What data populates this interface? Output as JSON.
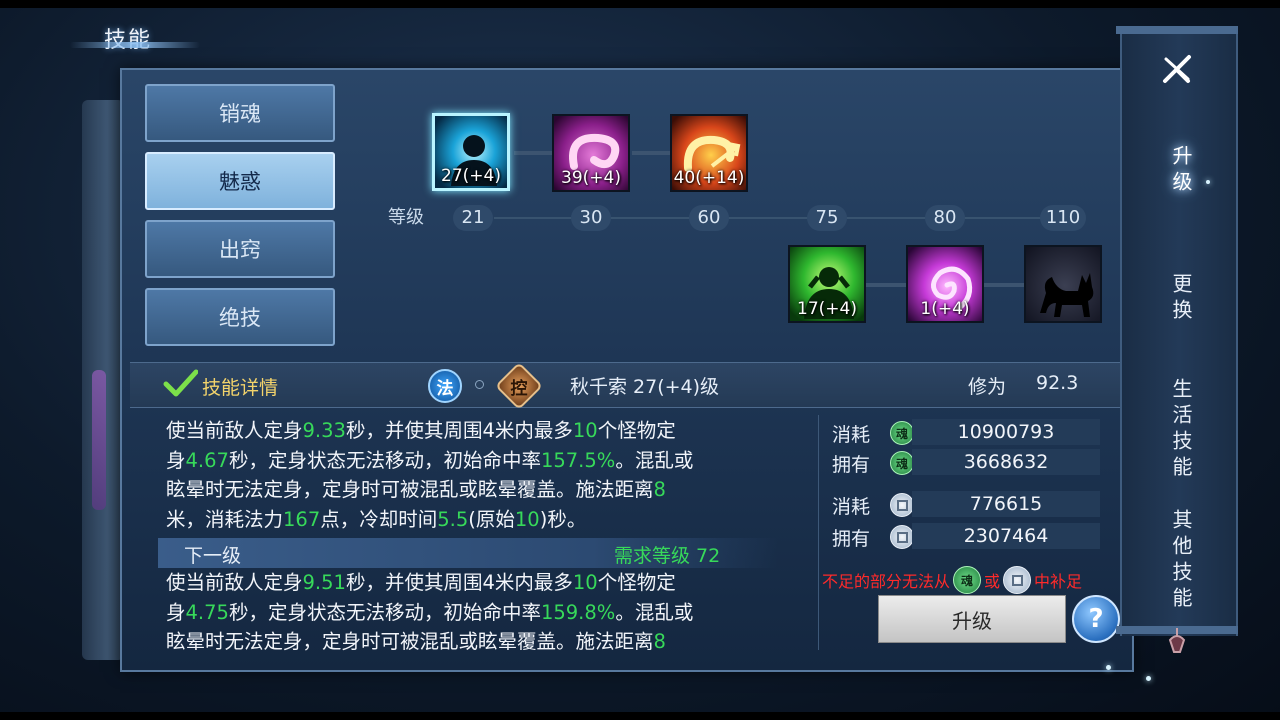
{
  "screen": {
    "title": "技能"
  },
  "tabs": [
    {
      "label": "销魂",
      "active": false
    },
    {
      "label": "魅惑",
      "active": true
    },
    {
      "label": "出窍",
      "active": false
    },
    {
      "label": "绝技",
      "active": false
    }
  ],
  "skill_tree": {
    "level_label": "等级",
    "levels": [
      "21",
      "30",
      "60",
      "75",
      "80",
      "110"
    ],
    "row1": [
      {
        "icon": "silhouette-skill-icon",
        "level_text": "27(+4)",
        "selected": true
      },
      {
        "icon": "pink-ribbon-skill-icon",
        "level_text": "39(+4)"
      },
      {
        "icon": "fire-arrow-skill-icon",
        "level_text": "40(+14)"
      }
    ],
    "row2": [
      {
        "icon": "green-figure-skill-icon",
        "level_text": "17(+4)"
      },
      {
        "icon": "purple-vortex-skill-icon",
        "level_text": "1(+4)"
      },
      {
        "icon": "fox-silhouette-skill-icon",
        "level_text": ""
      }
    ]
  },
  "detail": {
    "label": "技能详情",
    "badge_fa": "法",
    "badge_kong": "控",
    "skill_name": "秋千索 27(+4)级",
    "xiuwei_label": "修为",
    "xiuwei_value": "92.3",
    "current": {
      "line1": [
        "使当前敌人定身",
        "9.33",
        "秒，并使其周围4米内最多",
        "10",
        "个怪物定"
      ],
      "line2": [
        "身",
        "4.67",
        "秒，定身状态无法移动，初始命中率",
        "157.5%",
        "。混乱或"
      ],
      "line3": [
        "眩晕时无法定身，定身时可被混乱或眩晕覆盖。施法距离",
        "8",
        ""
      ],
      "line4": [
        "米，消耗法力",
        "167",
        "点，冷却时间",
        "5.5",
        "(原始",
        "10",
        ")秒。"
      ]
    },
    "next_label": "下一级",
    "req_label": "需求等级 72",
    "next": {
      "line1": [
        "使当前敌人定身",
        "9.51",
        "秒，并使其周围4米内最多",
        "10",
        "个怪物定"
      ],
      "line2": [
        "身",
        "4.75",
        "秒，定身状态无法移动，初始命中率",
        "159.8%",
        "。混乱或"
      ],
      "line3": [
        "眩晕时无法定身，定身时可被混乱或眩晕覆盖。施法距离",
        "8",
        ""
      ]
    }
  },
  "resources": [
    {
      "label": "消耗",
      "icon": "jade-currency-icon",
      "value": "10900793"
    },
    {
      "label": "拥有",
      "icon": "jade-currency-icon",
      "value": "3668632"
    },
    {
      "label": "消耗",
      "icon": "silver-coin-icon",
      "value": "776615"
    },
    {
      "label": "拥有",
      "icon": "silver-coin-icon",
      "value": "2307464"
    }
  ],
  "warning": {
    "part1": "不足的部分无法从",
    "part2": "或",
    "part3": "中补足"
  },
  "buttons": {
    "upgrade": "升级",
    "help": "?"
  },
  "side_nav": [
    {
      "label": "升级",
      "active": true
    },
    {
      "label": "更换",
      "active": false
    },
    {
      "label": "生活技能",
      "active": false
    },
    {
      "label": "其他技能",
      "active": false
    }
  ],
  "colors": {
    "highlight_green": "#37d95a",
    "warning_red": "#ff2a2a",
    "gold_label": "#f3d36b"
  }
}
